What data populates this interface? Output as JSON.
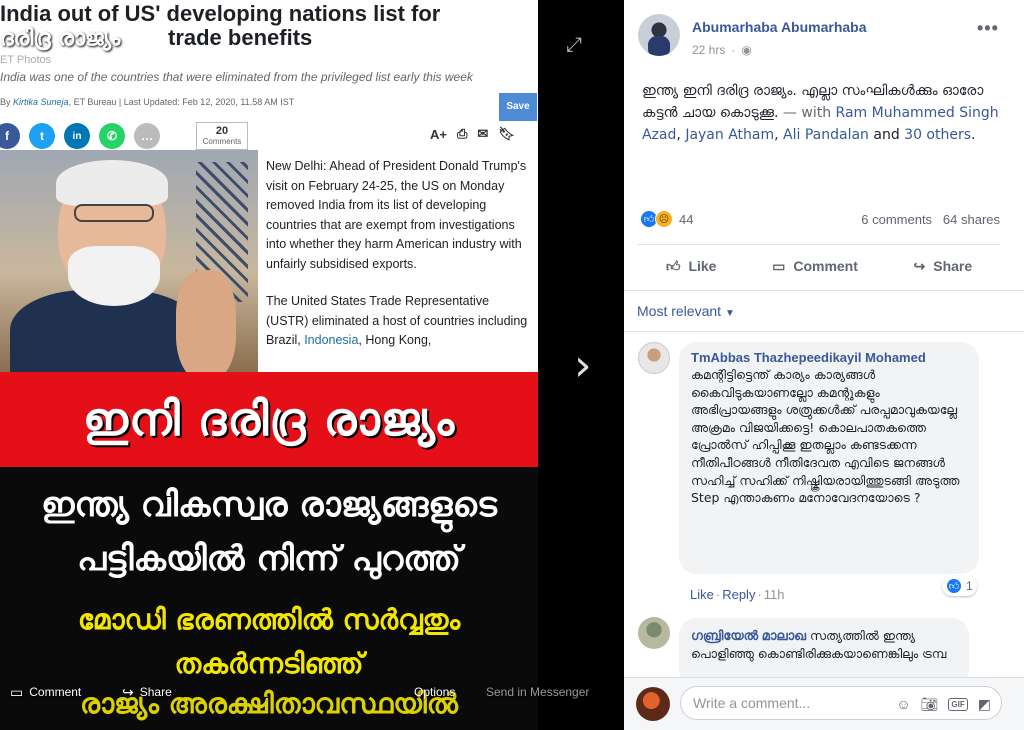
{
  "photo": {
    "headline": "India out of US' developing nations list for",
    "headline_overlay": "ദരിദ്ര രാജ്യം",
    "headline_tail": "trade benefits",
    "source_tag": "ET Photos",
    "subtitle": "India was one of the countries that were eliminated from the privileged list early this week",
    "byline_by": "By",
    "byline_author": "Kirtika Suneja",
    "byline_rest": ", ET Bureau  |  Last Updated: Feb 12, 2020, 11.58 AM IST",
    "save_label": "Save",
    "comments_count": "20",
    "comments_label": "Comments",
    "article_p1": "New Delhi: Ahead of President Donald Trump's visit on February 24-25, the US on Monday removed India from its list of developing countries that are exempt from investigations into whether they harm American industry with unfairly subsidised exports.",
    "article_p2_a": "The United States Trade Representative (USTR) eliminated a host of countries including Brazil, ",
    "article_p2_link": "Indonesia",
    "article_p2_b": ", Hong Kong,",
    "banner_red": "ഇനി ദരിദ്ര രാജ്യം",
    "banner_line1": "ഇന്ത്യ വികസ്വര രാജ്യങ്ങളുടെ",
    "banner_line2": "പട്ടികയിൽ നിന്ന് പുറത്ത്",
    "banner_line3": "മോഡി ഭരണത്തിൽ സർവ്വതും",
    "banner_line4": "തകർന്നടിഞ്ഞ്",
    "banner_line5": "രാജ്യം അരക്ഷിതാവസ്ഥയിൽ"
  },
  "viewer_bar": {
    "comment": "Comment",
    "share": "Share",
    "options": "Options",
    "send": "Send in Messenger"
  },
  "post": {
    "author": "Abumarhaba Abumarhaba",
    "time": "22 hrs",
    "text_main": "ഇന്ത്യ ഇനി ദരിദ്ര രാജ്യം. എല്ലാ സംഘികൾക്കും ഓരോ കട്ടൻ ചായ കൊടുക്കൂ.",
    "with_prefix": " — with ",
    "tag1": "Ram Muhammed Singh Azad",
    "tag2": "Jayan Atham",
    "tag3": "Ali Pandalan",
    "and_word": " and ",
    "tag_others": "30 others",
    "reaction_count": "44",
    "comments_count": "6 comments",
    "shares_count": "64 shares",
    "like_label": "Like",
    "comment_label": "Comment",
    "share_label": "Share"
  },
  "comments": {
    "sort_label": "Most relevant",
    "c1": {
      "name": "TmAbbas Thazhepeedikayil Mohamed",
      "text": "കമന്റിട്ടിട്ടെന്ത് കാര്യം കാര്യങ്ങൾ കൈവിടുകയാണല്ലോ കമന്റുകളും അഭിപ്രായങ്ങളും ശത്രുക്കൾക്ക് പരപ്പമാവുകയല്ലേ അക്രമം വിജയിക്കട്ടെ! കൊലപാതകത്തെ പ്രോൽസ് ഹിപ്പിക്കൂ ഇതല്ലാം കണ്ടടക്കന്ന നീതിപീഠങ്ങൾ നീതിദേവത എവിടെ ജനങ്ങൾ സഹിച്ച് സഹിക്ക് നിഷ്ക്രിയരായിത്തുടങ്ങി അടുത്ത Step എന്താകണം മനോവേദനയോടെ ?",
      "reactions": "1",
      "like": "Like",
      "reply": "Reply",
      "time": "11h"
    },
    "c2": {
      "name": "ഗബ്രിയേൽ മാലാഖ",
      "text": " സത്യത്തിൽ ഇന്ത്യ പൊളിഞ്ഞു കൊണ്ടിരിക്കുകയാണെങ്കിലും ട്രമ്പ"
    },
    "composer_placeholder": "Write a comment..."
  }
}
